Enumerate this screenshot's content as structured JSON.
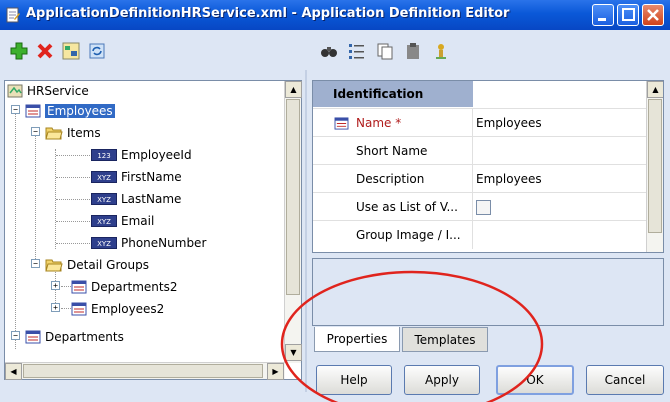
{
  "window": {
    "title": "ApplicationDefinitionHRService.xml - Application Definition Editor",
    "icon": "document-edit-icon",
    "buttons": [
      "minimize",
      "maximize",
      "close"
    ]
  },
  "left_toolbar": [
    "add-icon",
    "delete-icon",
    "tree-edit-icon",
    "refresh-icon"
  ],
  "right_toolbar": [
    "binoculars-icon",
    "categorized-icon",
    "copy-icon",
    "paste-icon",
    "help-icon"
  ],
  "tree": {
    "root": "HRService",
    "employees": "Employees",
    "items": "Items",
    "fields": [
      "EmployeeId",
      "FirstName",
      "LastName",
      "Email",
      "PhoneNumber"
    ],
    "detail_groups": "Detail Groups",
    "groups": [
      "Departments2",
      "Employees2"
    ],
    "departments": "Departments"
  },
  "properties": {
    "category": "Identification",
    "rows": [
      {
        "name": "Name *",
        "value": "Employees"
      },
      {
        "name": "Short Name",
        "value": ""
      },
      {
        "name": "Description",
        "value": "Employees"
      },
      {
        "name": "Use as List of V...",
        "value": ""
      },
      {
        "name": "Group Image / I...",
        "value": ""
      }
    ]
  },
  "tabs": {
    "properties": "Properties",
    "templates": "Templates"
  },
  "buttons": {
    "help": "Help",
    "apply": "Apply",
    "ok": "OK",
    "cancel": "Cancel"
  },
  "colors": {
    "titlebar": "#0a58d8",
    "selection": "#316ac5",
    "annotation": "#e0241d"
  }
}
